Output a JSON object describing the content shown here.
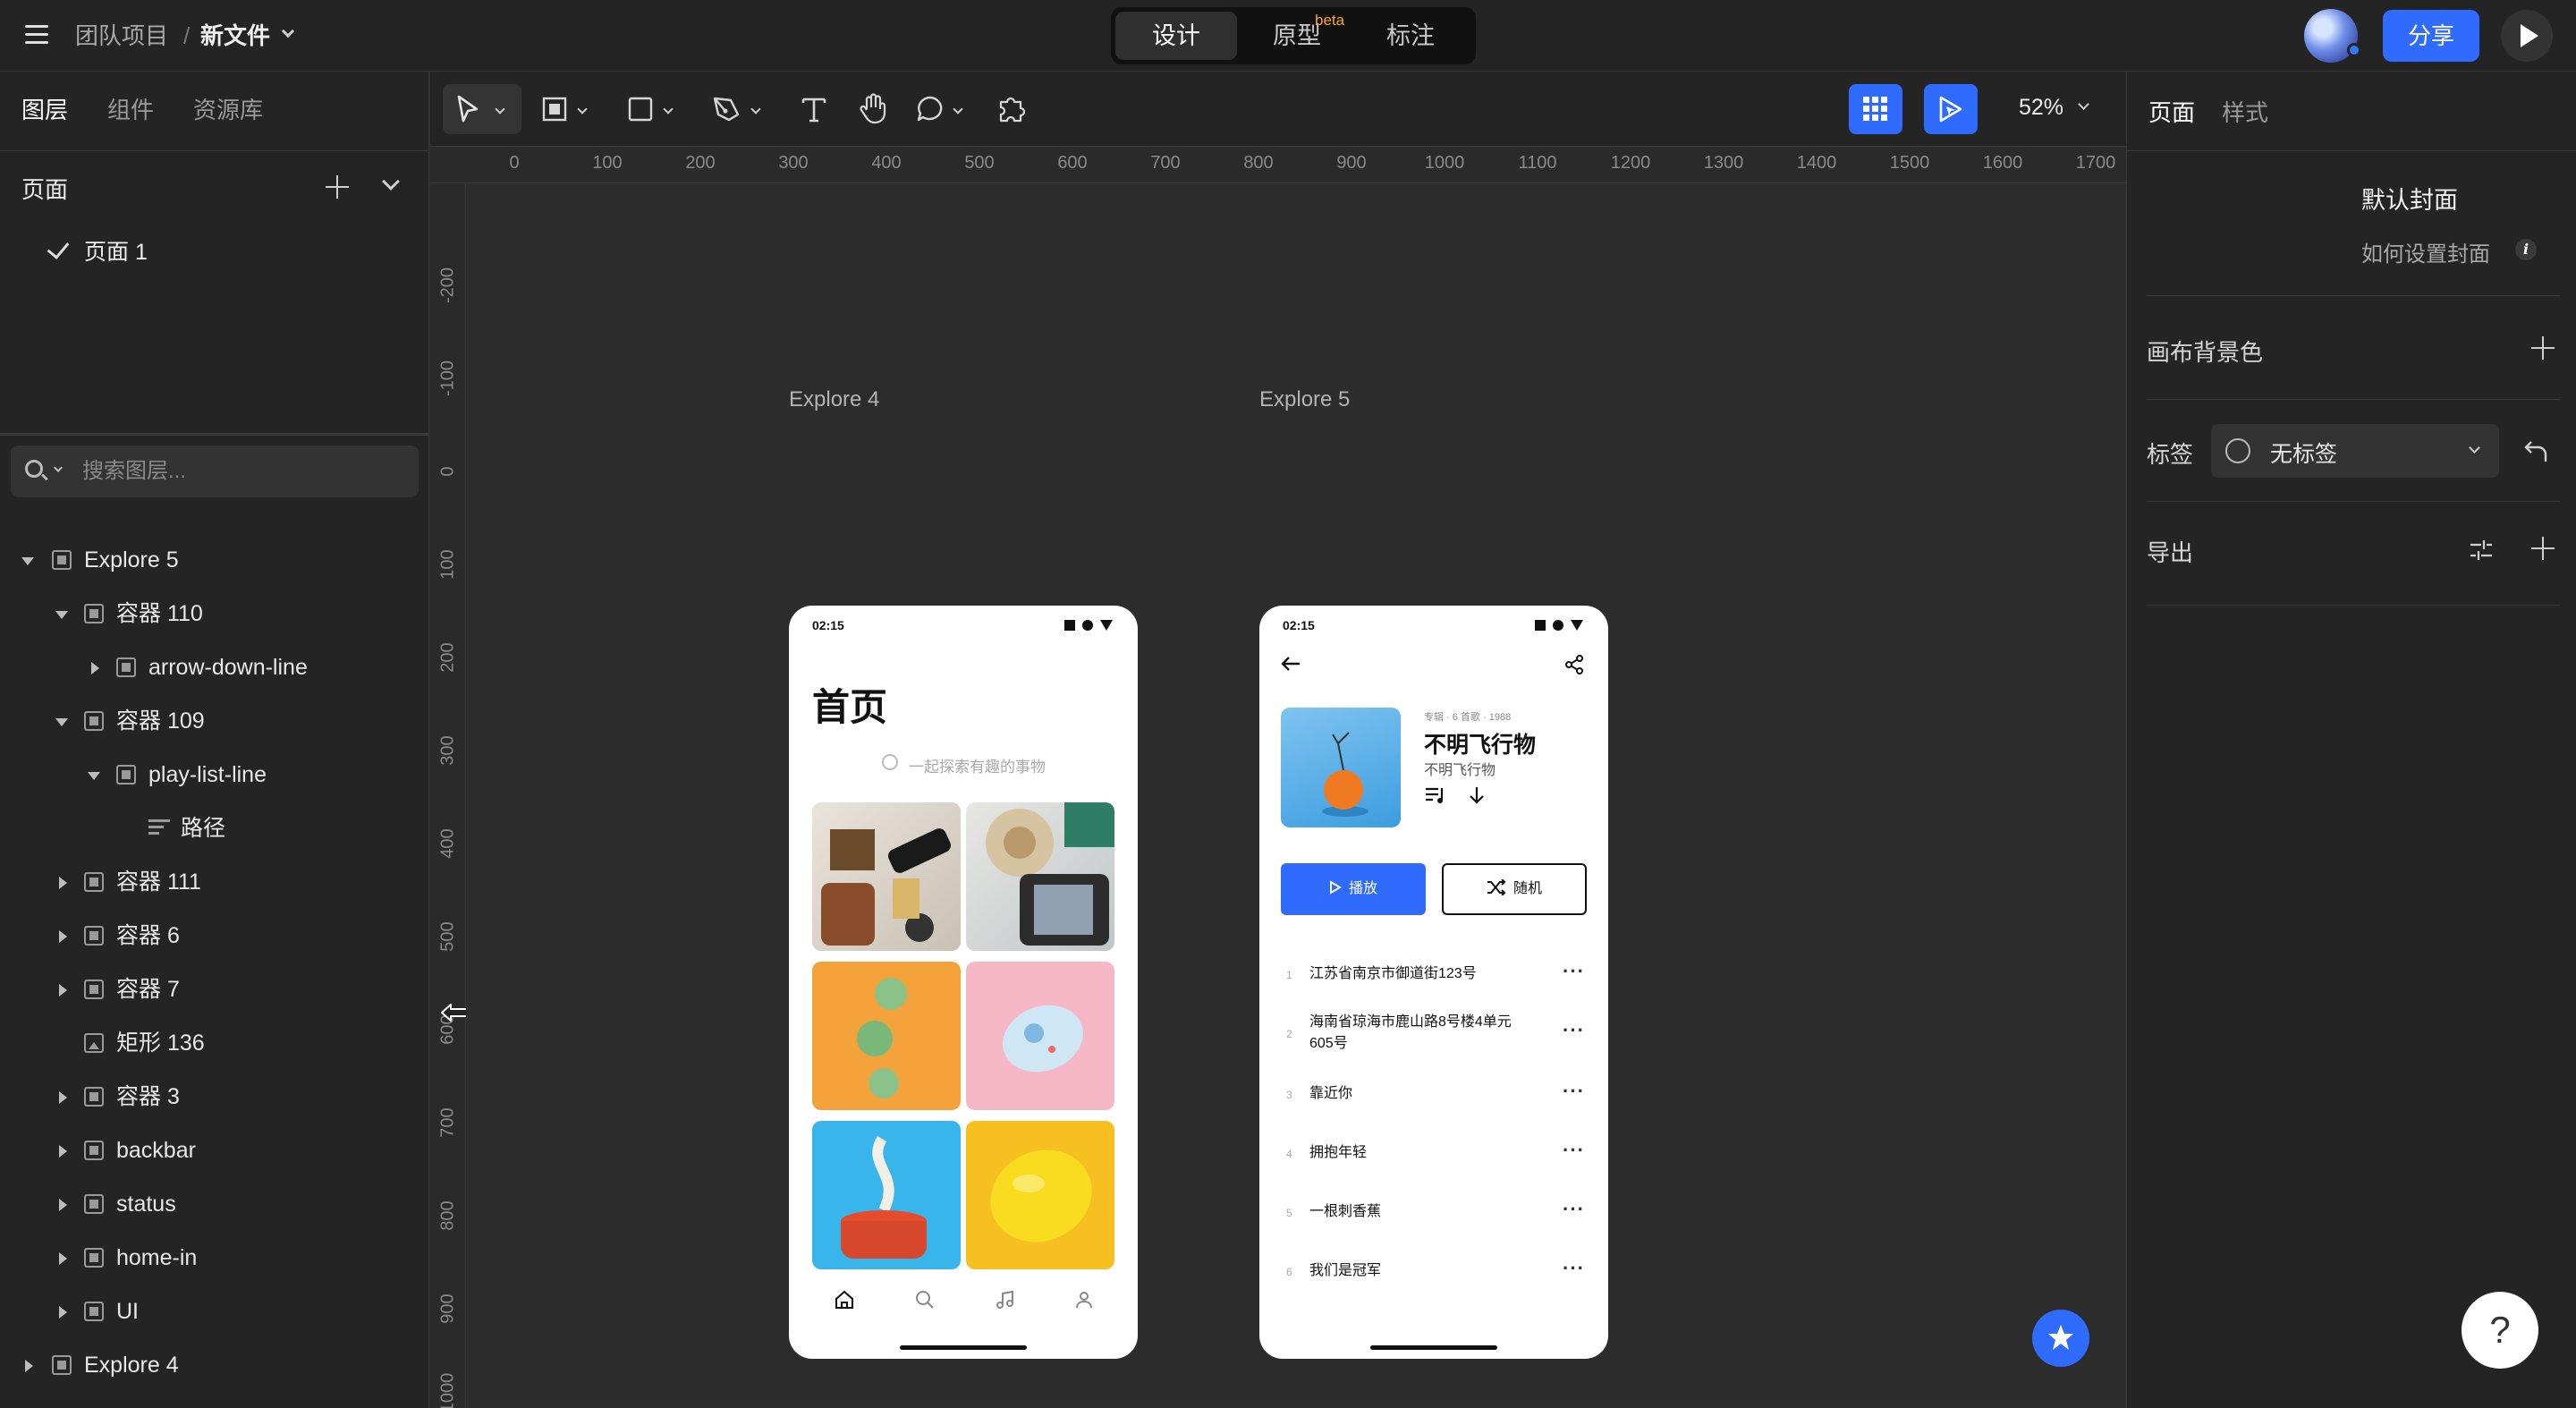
{
  "header": {
    "team": "团队项目",
    "separator": "/",
    "file_name": "新文件",
    "modes": [
      "设计",
      "原型",
      "标注"
    ],
    "beta": "beta",
    "share": "分享"
  },
  "left_panel": {
    "tabs": [
      "图层",
      "组件",
      "资源库"
    ],
    "pages_title": "页面",
    "pages": [
      "页面 1"
    ],
    "search_placeholder": "搜索图层...",
    "layers": [
      {
        "label": "Explore 5"
      },
      {
        "label": "容器 110"
      },
      {
        "label": "arrow-down-line"
      },
      {
        "label": "容器 109"
      },
      {
        "label": "play-list-line"
      },
      {
        "label": "路径"
      },
      {
        "label": "容器 111"
      },
      {
        "label": "容器 6"
      },
      {
        "label": "容器 7"
      },
      {
        "label": "矩形 136"
      },
      {
        "label": "容器 3"
      },
      {
        "label": "backbar"
      },
      {
        "label": "status"
      },
      {
        "label": "home-in"
      },
      {
        "label": "UI"
      },
      {
        "label": "Explore 4"
      }
    ]
  },
  "toolbar": {
    "zoom": "52%"
  },
  "rulers": {
    "top": [
      "0",
      "100",
      "200",
      "300",
      "400",
      "500",
      "600",
      "700",
      "800",
      "900",
      "1000",
      "1100",
      "1200",
      "1300",
      "1400",
      "1500",
      "1600",
      "1700"
    ],
    "left": [
      "-200",
      "-100",
      "0",
      "100",
      "200",
      "300",
      "400",
      "500",
      "600",
      "700",
      "800",
      "900",
      "1000"
    ]
  },
  "canvas": {
    "explore4": {
      "label": "Explore 4",
      "time": "02:15",
      "title": "首页",
      "search_placeholder": "一起探索有趣的事物"
    },
    "explore5": {
      "label": "Explore 5",
      "time": "02:15",
      "meta": "专辑 · 6 首歌 · 1988",
      "album_title": "不明飞行物",
      "artist": "不明飞行物",
      "play": "播放",
      "shuffle": "随机",
      "tracks": [
        {
          "num": "1",
          "name": "江苏省南京市御道街123号"
        },
        {
          "num": "2",
          "name": "海南省琼海市鹿山路8号楼4单元605号"
        },
        {
          "num": "3",
          "name": "靠近你"
        },
        {
          "num": "4",
          "name": "拥抱年轻"
        },
        {
          "num": "5",
          "name": "一根刺香蕉"
        },
        {
          "num": "6",
          "name": "我们是冠军"
        }
      ]
    }
  },
  "right_panel": {
    "tabs": [
      "页面",
      "样式"
    ],
    "cover_title": "默认封面",
    "cover_help": "如何设置封面",
    "info": "i",
    "canvas_bg": "画布背景色",
    "tag_label": "标签",
    "tag_value": "无标签",
    "export": "导出"
  },
  "help": "?"
}
